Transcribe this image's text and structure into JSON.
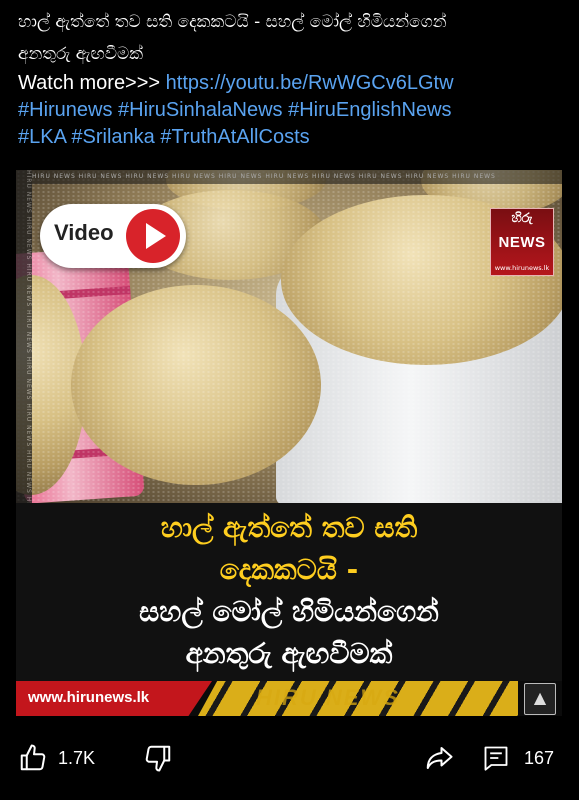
{
  "post": {
    "title_line1": "හාල් ඇත්තේ තව සති දෙකකටයි - සහල් මෝල් හිමියන්ගෙන්",
    "title_line2": "අනතුරු ඇඟවීමක්",
    "watch_more": "Watch more>>> ",
    "link": "https://youtu.be/RwWGCv6LGtw",
    "hashtags_line1": "#Hirunews #HiruSinhalaNews #HiruEnglishNews",
    "hashtags_line2": "#LKA #Srilanka #TruthAtAllCosts"
  },
  "media": {
    "video_label": "Video",
    "logo_top": "හිරු",
    "logo_news": "NEWS",
    "logo_url": "www.hirunews.lk",
    "strip_text": "HIRU NEWS HIRU NEWS HIRU NEWS HIRU NEWS HIRU NEWS HIRU NEWS HIRU NEWS HIRU NEWS HIRU NEWS HIRU NEWS",
    "caption_line1": "හාල් ඇත්තේ තව සති",
    "caption_line2": "දෙකකටයි -",
    "caption_line3": "සහල් මෝල් හිමියන්ගෙන්",
    "caption_line4": "අනතුරු ඇඟවීමක්",
    "footer_url": "www.hirunews.lk",
    "footer_watermark": "HIRU NEWS",
    "gallery_icon": "image-icon"
  },
  "actions": {
    "like_count": "1.7K",
    "comment_count": "167"
  },
  "colors": {
    "link": "#5aa3f0",
    "caption_yellow": "#ffce1f",
    "brand_red": "#c3161c"
  }
}
